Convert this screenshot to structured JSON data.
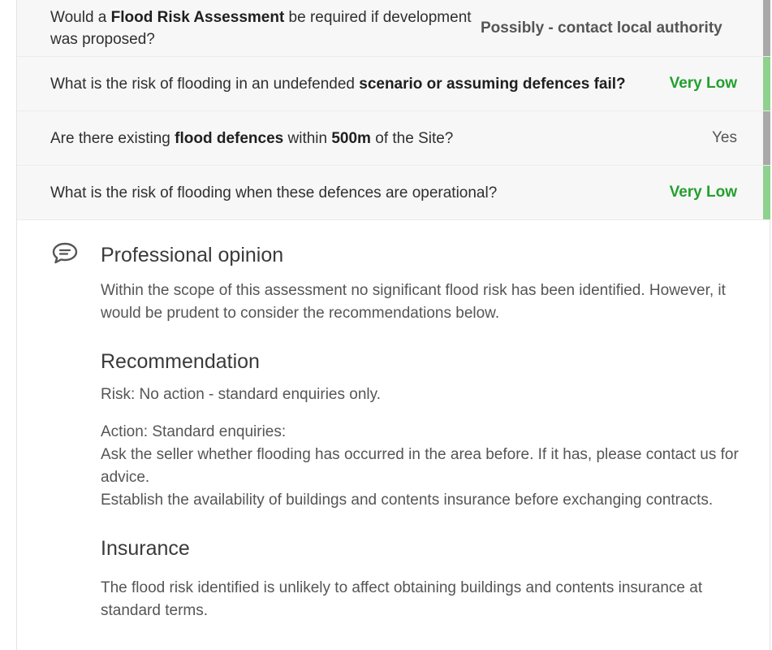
{
  "rows": [
    {
      "q_parts": [
        "Would a ",
        "Flood Risk Assessment",
        " be required if development was proposed?"
      ],
      "answer": "Possibly - contact local authority",
      "status": "grey"
    },
    {
      "q_parts": [
        "What is the risk of flooding in an undefended ",
        "scenario or assuming defences fail?"
      ],
      "answer": "Very Low",
      "status": "green"
    },
    {
      "q_parts": [
        "Are there existing ",
        "flood defences",
        " within ",
        "500m",
        " of the Site?"
      ],
      "answer": "Yes",
      "status": "grey"
    },
    {
      "q_parts": [
        "What is the risk of flooding when these defences are operational?"
      ],
      "answer": "Very Low",
      "status": "green"
    }
  ],
  "opinion": {
    "icon": "speech-bubble-icon",
    "title": "Professional opinion",
    "text": "Within the scope of this assessment no significant flood risk has been identified. However, it would be prudent to consider the recommendations below.",
    "recommendation": {
      "title": "Recommendation",
      "risk": "Risk: No action - standard enquiries only.",
      "action_lines": [
        "Action: Standard enquiries:",
        "Ask the seller whether flooding has occurred in the area before. If it has, please contact us for advice.",
        "Establish the availability of buildings and contents insurance before exchanging contracts."
      ]
    },
    "insurance": {
      "title": "Insurance",
      "text": "The flood risk identified is unlikely to affect obtaining buildings and contents insurance at standard terms."
    }
  },
  "colors": {
    "green_text": "#23a02e",
    "green_bar": "#8fd18f",
    "grey_bar": "#a9a9a9",
    "row_bg": "#f7f7f7"
  }
}
